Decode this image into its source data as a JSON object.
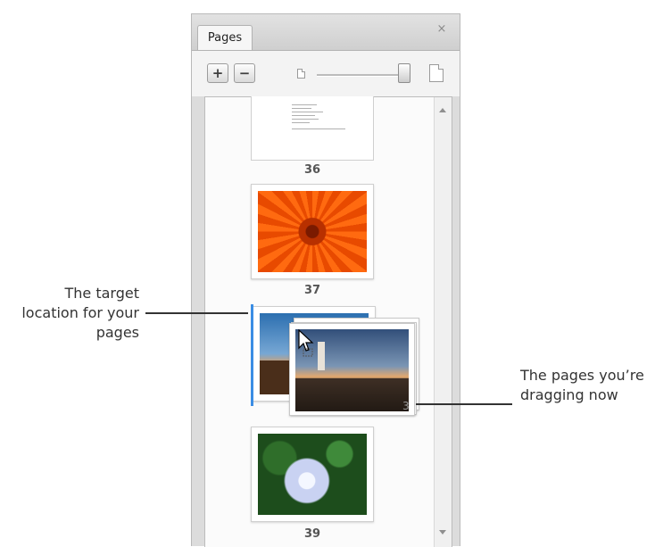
{
  "panel": {
    "tab_label": "Pages",
    "close_glyph": "×",
    "toolbar": {
      "add_glyph": "+",
      "remove_glyph": "−",
      "zoom_slider_level": 0.95
    }
  },
  "thumbnails": [
    {
      "page": "36",
      "image": "document-page"
    },
    {
      "page": "37",
      "image": "orange-flower-photo"
    },
    {
      "page": "",
      "image": "landscape-photo"
    },
    {
      "page": "39",
      "image": "hydrangea-photo"
    }
  ],
  "drag": {
    "count": "3",
    "image": "lighthouse-photo",
    "drop_indicator_color": "#3b8de4"
  },
  "callouts": {
    "target": [
      "The target",
      "location for your",
      "pages"
    ],
    "dragging": [
      "The pages you’re",
      "dragging now"
    ]
  }
}
